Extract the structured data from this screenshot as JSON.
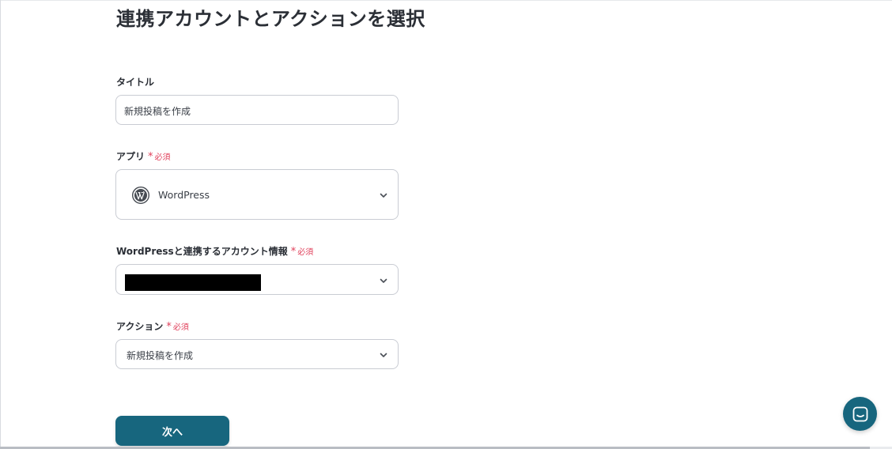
{
  "page": {
    "title": "連携アカウントとアクションを選択"
  },
  "form": {
    "title_field": {
      "label": "タイトル",
      "value": "新規投稿を作成"
    },
    "app_field": {
      "label": "アプリ",
      "required_star": "*",
      "required_text": "必須",
      "value": "WordPress",
      "icon": "wordpress-icon"
    },
    "account_field": {
      "label": "WordPressと連携するアカウント情報",
      "required_star": "*",
      "required_text": "必須",
      "value_redacted": true
    },
    "action_field": {
      "label": "アクション",
      "required_star": "*",
      "required_text": "必須",
      "value": "新規投稿を作成"
    },
    "next_button": {
      "label": "次へ"
    }
  },
  "colors": {
    "primary": "#17667e",
    "required": "#e0405b",
    "border": "#c9ccd3",
    "text": "#2b2f36"
  },
  "chat": {
    "icon": "chat-icon"
  }
}
